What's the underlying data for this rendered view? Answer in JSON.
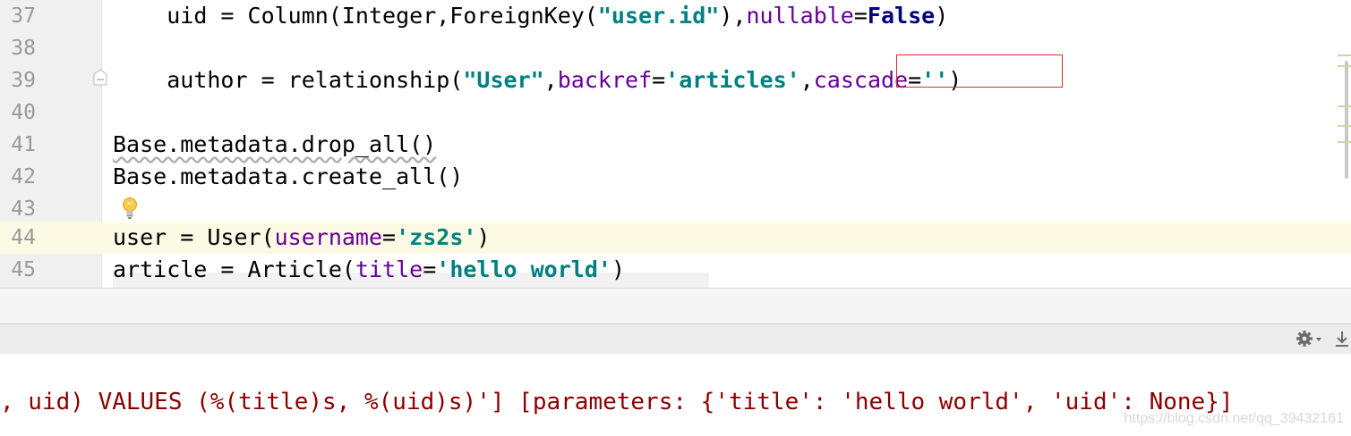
{
  "editor": {
    "lines": [
      {
        "num": "37",
        "indent": "    ",
        "plain1": "uid = Column(Integer,ForeignKey(",
        "str1": "\"user.id\"",
        "plain2": "),",
        "param1": "nullable",
        "plain3": "=",
        "kw1": "False",
        "plain4": ")"
      },
      {
        "num": "38"
      },
      {
        "num": "39",
        "indent": "    ",
        "plain1": "author = relationship(",
        "str1": "\"User\"",
        "plain2": ",",
        "param1": "backref",
        "plain3": "=",
        "str2": "'articles'",
        "plain4": ",",
        "param2": "cascade",
        "plain5": "=",
        "str3": "''",
        "plain6": ")"
      },
      {
        "num": "40"
      },
      {
        "num": "41",
        "plain1": "Base.metadata.drop_all()"
      },
      {
        "num": "42",
        "plain1": "Base.metadata.create_all()"
      },
      {
        "num": "43"
      },
      {
        "num": "44",
        "plain1": "user = User(",
        "param1": "username",
        "plain2": "=",
        "str1": "'zs2s'",
        "plain3": ")"
      },
      {
        "num": "45",
        "plain1": "article = Article(",
        "param1": "title",
        "plain2": "=",
        "str1": "'hello world'",
        "plain3": ")"
      }
    ]
  },
  "icons": {
    "fold": "fold-marker-icon",
    "bulb": "lightbulb-icon",
    "gear": "gear-icon",
    "download": "download-icon"
  },
  "console": {
    "output": ", uid) VALUES (%(title)s, %(uid)s)'] [parameters: {'title': 'hello world', 'uid': None}]"
  },
  "watermark": "https://blog.csdn.net/qq_39432161",
  "colors": {
    "keyword": "#000080",
    "string": "#008080",
    "param": "#660099",
    "console_error": "#8b0000",
    "highlight_box": "#d32f2f",
    "current_line": "#fcfae5"
  }
}
